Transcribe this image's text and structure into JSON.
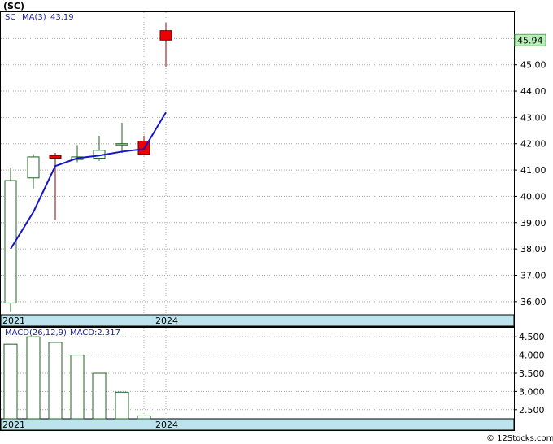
{
  "header": {
    "symbol_title": "(SC)"
  },
  "price_panel": {
    "legend_symbol": "SC",
    "legend_ma": "MA(3)",
    "legend_ma_value": "43.19",
    "last_price_label": "45.94",
    "last_price": 45.94,
    "y_ticks": [
      "46.00",
      "45.00",
      "44.00",
      "43.00",
      "42.00",
      "41.00",
      "40.00",
      "39.00",
      "38.00",
      "37.00",
      "36.00"
    ],
    "x_labels": [
      "2021",
      "2024"
    ]
  },
  "macd_panel": {
    "legend_title": "MACD(26,12,9)",
    "legend_value": "MACD:2.317",
    "y_ticks": [
      "4.500",
      "4.000",
      "3.500",
      "3.000",
      "2.500"
    ],
    "x_labels": [
      "2021",
      "2024"
    ]
  },
  "footer": {
    "credit": "© 12Stocks.com"
  },
  "colors": {
    "up_body": "#ffffff",
    "up_border": "#1f5f1f",
    "down_body": "#ee0000",
    "ma_line": "#1515c8",
    "macd_bar": "#1f5f1f",
    "axis_band": "#bde3ec",
    "last_price_bg": "#b8f0b8"
  },
  "chart_data": [
    {
      "type": "candlestick",
      "title": "(SC)",
      "categories": [
        "2021",
        "",
        "",
        "",
        "",
        "",
        "",
        "2024"
      ],
      "series": [
        {
          "name": "SC",
          "ohlc": [
            {
              "open": 35.95,
              "high": 41.1,
              "low": 35.6,
              "close": 40.6
            },
            {
              "open": 40.7,
              "high": 41.6,
              "low": 40.3,
              "close": 41.5
            },
            {
              "open": 41.55,
              "high": 41.65,
              "low": 39.1,
              "close": 41.45
            },
            {
              "open": 41.4,
              "high": 41.95,
              "low": 41.3,
              "close": 41.5
            },
            {
              "open": 41.45,
              "high": 42.3,
              "low": 41.35,
              "close": 41.75
            },
            {
              "open": 42.0,
              "high": 42.8,
              "low": 41.65,
              "close": 42.0
            },
            {
              "open": 42.1,
              "high": 42.3,
              "low": 41.55,
              "close": 41.6
            },
            {
              "open": 46.3,
              "high": 46.6,
              "low": 44.9,
              "close": 45.94
            }
          ]
        },
        {
          "name": "MA(3)",
          "values": [
            38.0,
            39.4,
            41.15,
            41.45,
            41.55,
            41.7,
            41.8,
            43.19
          ]
        }
      ],
      "ylim": [
        35.5,
        47.0
      ]
    },
    {
      "type": "bar",
      "title": "MACD(26,12,9)",
      "categories": [
        "2021",
        "",
        "",
        "",
        "",
        "",
        "",
        "2024"
      ],
      "series": [
        {
          "name": "MACD",
          "values": [
            4.3,
            4.5,
            4.35,
            4.0,
            3.5,
            2.98,
            2.33,
            null
          ]
        }
      ],
      "ylim": [
        2.25,
        4.75
      ]
    }
  ]
}
